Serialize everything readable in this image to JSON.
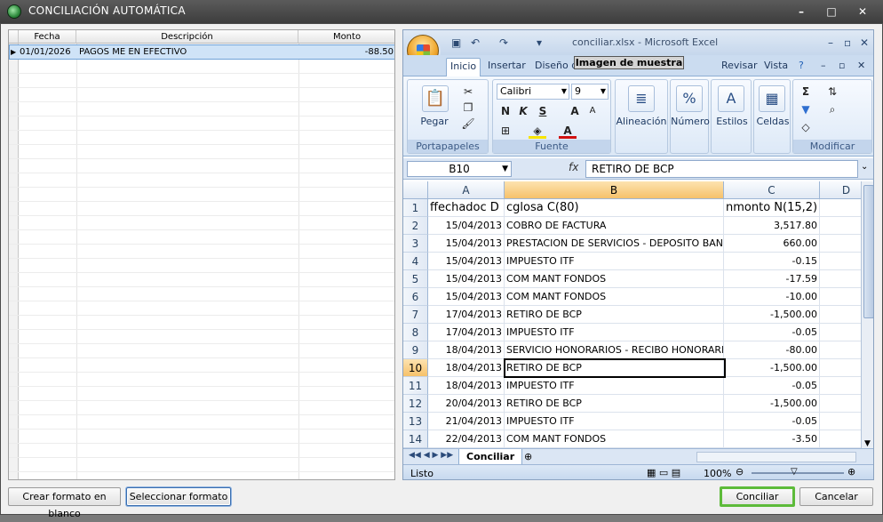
{
  "window": {
    "title": "CONCILIACIÓN AUTOMÁTICA",
    "controls": [
      "–",
      "□",
      "✕"
    ]
  },
  "left_table": {
    "columns": [
      "Fecha",
      "Descripción",
      "Monto"
    ],
    "rows": [
      {
        "fecha": "01/01/2026",
        "descripcion": "PAGOS ME EN EFECTIVO",
        "monto": "-88.50"
      }
    ]
  },
  "excel": {
    "window_title": "conciliar.xlsx - Microsoft Excel",
    "watermark": "Imagen de muestra",
    "tabs": [
      "Inicio",
      "Insertar",
      "Diseño de",
      "Revisar",
      "Vista"
    ],
    "clipboard": {
      "paste_label": "Pegar",
      "group_label": "Portapapeles"
    },
    "font": {
      "name": "Calibri",
      "size": "9",
      "bold": "N",
      "italic": "K",
      "underline": "S",
      "grow": "A",
      "shrink": "A",
      "color": "A",
      "group_label": "Fuente"
    },
    "ribbon_buttons": {
      "alignment": "Alineación",
      "number": "Número",
      "styles": "Estilos",
      "cells": "Celdas",
      "group_label": "Modificar"
    },
    "formula_bar": {
      "name_box": "B10",
      "fx": "fx",
      "content": "RETIRO DE BCP"
    },
    "column_headers": [
      "A",
      "B",
      "C",
      "D"
    ],
    "rows": [
      {
        "n": "1",
        "a": "ffechadoc D",
        "b": "cglosa C(80)",
        "c": "nmonto N(15,2)"
      },
      {
        "n": "2",
        "a": "15/04/2013",
        "b": "COBRO DE FACTURA",
        "c": "3,517.80"
      },
      {
        "n": "3",
        "a": "15/04/2013",
        "b": "PRESTACION DE SERVICIOS - DEPOSITO BANCO",
        "c": "660.00"
      },
      {
        "n": "4",
        "a": "15/04/2013",
        "b": "IMPUESTO ITF",
        "c": "-0.15"
      },
      {
        "n": "5",
        "a": "15/04/2013",
        "b": "COM MANT FONDOS",
        "c": "-17.59"
      },
      {
        "n": "6",
        "a": "15/04/2013",
        "b": "COM MANT FONDOS",
        "c": "-10.00"
      },
      {
        "n": "7",
        "a": "17/04/2013",
        "b": "RETIRO DE BCP",
        "c": "-1,500.00"
      },
      {
        "n": "8",
        "a": "17/04/2013",
        "b": "IMPUESTO ITF",
        "c": "-0.05"
      },
      {
        "n": "9",
        "a": "18/04/2013",
        "b": "SERVICIO HONORARIOS - RECIBO HONORARIO -",
        "c": "-80.00"
      },
      {
        "n": "10",
        "a": "18/04/2013",
        "b": "RETIRO DE BCP",
        "c": "-1,500.00"
      },
      {
        "n": "11",
        "a": "18/04/2013",
        "b": "IMPUESTO ITF",
        "c": "-0.05"
      },
      {
        "n": "12",
        "a": "20/04/2013",
        "b": "RETIRO DE BCP",
        "c": "-1,500.00"
      },
      {
        "n": "13",
        "a": "21/04/2013",
        "b": "IMPUESTO ITF",
        "c": "-0.05"
      },
      {
        "n": "14",
        "a": "22/04/2013",
        "b": "COM MANT FONDOS",
        "c": "-3.50"
      }
    ],
    "sheet_tab": "Conciliar",
    "status": {
      "ready": "Listo",
      "zoom": "100%"
    }
  },
  "buttons": {
    "blank_format": "Crear formato en blanco",
    "select_format": "Seleccionar formato",
    "reconcile": "Conciliar",
    "cancel": "Cancelar"
  },
  "colors": {
    "accent_green": "#5dbb3a",
    "selection_orange": "#f6c16a",
    "row_selected_blue": "#cfe3f7"
  }
}
